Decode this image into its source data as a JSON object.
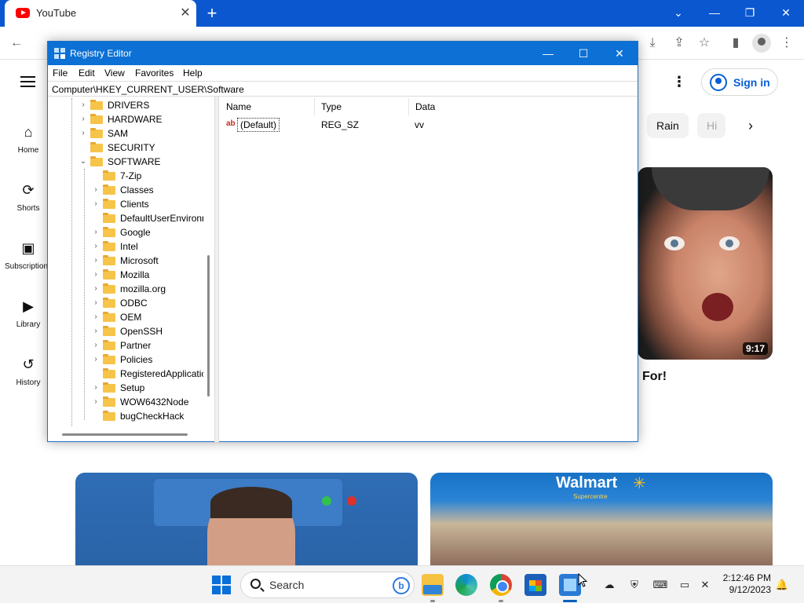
{
  "chrome": {
    "tab_title": "YouTube",
    "tab_close": "✕",
    "new_tab": "+",
    "window_buttons": [
      "⌄",
      "—",
      "❐",
      "✕"
    ]
  },
  "youtube": {
    "nav": [
      {
        "label": "Home",
        "icon": "home-icon"
      },
      {
        "label": "Shorts",
        "icon": "shorts-icon"
      },
      {
        "label": "Subscriptions",
        "icon": "subscriptions-icon"
      },
      {
        "label": "Library",
        "icon": "library-icon"
      },
      {
        "label": "History",
        "icon": "history-icon"
      }
    ],
    "sign_in": "Sign in",
    "chips": [
      "Rain",
      "Hi"
    ],
    "video_duration": "9:17",
    "video_title": "For!",
    "thumb3_brand": "Walmart",
    "thumb3_sub": "Supercentre"
  },
  "regedit": {
    "title": "Registry Editor",
    "menu": [
      "File",
      "Edit",
      "View",
      "Favorites",
      "Help"
    ],
    "address": "Computer\\HKEY_CURRENT_USER\\Software",
    "tree_top": [
      {
        "label": "DRIVERS",
        "chev": "›"
      },
      {
        "label": "HARDWARE",
        "chev": "›"
      },
      {
        "label": "SAM",
        "chev": "›"
      },
      {
        "label": "SECURITY",
        "chev": ""
      },
      {
        "label": "SOFTWARE",
        "chev": "⌄"
      }
    ],
    "tree_children": [
      {
        "label": "7-Zip",
        "chev": ""
      },
      {
        "label": "Classes",
        "chev": "›"
      },
      {
        "label": "Clients",
        "chev": "›"
      },
      {
        "label": "DefaultUserEnvironn",
        "chev": ""
      },
      {
        "label": "Google",
        "chev": "›"
      },
      {
        "label": "Intel",
        "chev": "›"
      },
      {
        "label": "Microsoft",
        "chev": "›"
      },
      {
        "label": "Mozilla",
        "chev": "›"
      },
      {
        "label": "mozilla.org",
        "chev": "›"
      },
      {
        "label": "ODBC",
        "chev": "›"
      },
      {
        "label": "OEM",
        "chev": "›"
      },
      {
        "label": "OpenSSH",
        "chev": "›"
      },
      {
        "label": "Partner",
        "chev": "›"
      },
      {
        "label": "Policies",
        "chev": "›"
      },
      {
        "label": "RegisteredApplicatic",
        "chev": ""
      },
      {
        "label": "Setup",
        "chev": "›"
      },
      {
        "label": "WOW6432Node",
        "chev": "›"
      },
      {
        "label": "bugCheckHack",
        "chev": ""
      }
    ],
    "columns": [
      "Name",
      "Type",
      "Data"
    ],
    "values": [
      {
        "icon": "ab",
        "name": "(Default)",
        "type": "REG_SZ",
        "data": "vv"
      }
    ]
  },
  "taskbar": {
    "search_placeholder": "Search",
    "bing": "b",
    "time": "2:12:46 PM",
    "date": "9/12/2023"
  }
}
